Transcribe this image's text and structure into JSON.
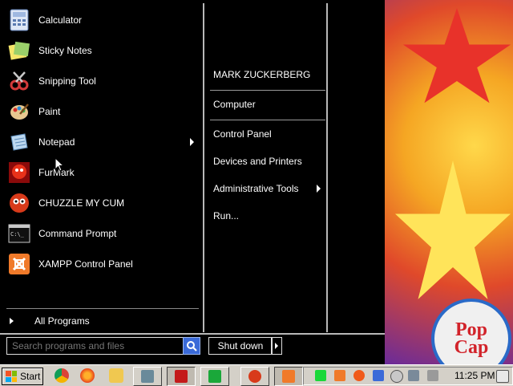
{
  "programs": [
    {
      "label": "Calculator",
      "icon": "calculator-icon",
      "color": "#7aa0d8"
    },
    {
      "label": "Sticky Notes",
      "icon": "sticky-notes-icon",
      "color": "#f5e66a"
    },
    {
      "label": "Snipping Tool",
      "icon": "snipping-tool-icon",
      "color": "#d43a3a"
    },
    {
      "label": "Paint",
      "icon": "paint-icon",
      "color": "#e8b04a"
    },
    {
      "label": "Notepad",
      "icon": "notepad-icon",
      "color": "#8ab8e0",
      "has_submenu": true
    },
    {
      "label": "FurMark",
      "icon": "furmark-icon",
      "color": "#c41a1a"
    },
    {
      "label": "CHUZZLE MY CUM",
      "icon": "chuzzle-icon",
      "color": "#d83a1a"
    },
    {
      "label": "Command Prompt",
      "icon": "command-prompt-icon",
      "color": "#202020"
    },
    {
      "label": "XAMPP Control Panel",
      "icon": "xampp-icon",
      "color": "#f07a2a"
    }
  ],
  "all_programs_label": "All Programs",
  "search": {
    "placeholder": "Search programs and files"
  },
  "right_items": [
    {
      "label": "MARK ZUCKERBERG"
    },
    {
      "label": "Computer"
    },
    {
      "label": "Control Panel"
    },
    {
      "label": "Devices and Printers"
    },
    {
      "label": "Administrative Tools",
      "has_submenu": true
    },
    {
      "label": "Run..."
    }
  ],
  "shutdown_label": "Shut down",
  "taskbar": {
    "start_label": "Start",
    "clock": "11:25 PM"
  },
  "colors": {
    "menu_bg": "#000000",
    "taskbar_bg": "#d4d0c8",
    "search_button": "#3a6ad8"
  }
}
